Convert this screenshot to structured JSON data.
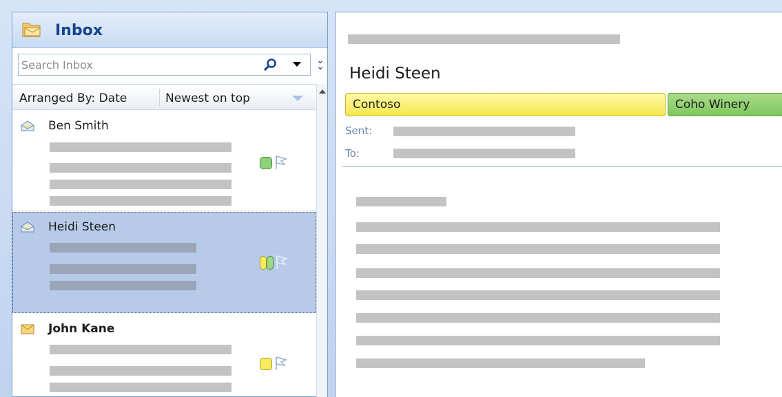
{
  "inbox": {
    "title": "Inbox",
    "search_placeholder": "Search Inbox",
    "arranged_by": "Arranged By: Date",
    "sort_order": "Newest on top"
  },
  "messages": [
    {
      "sender": "Ben Smith",
      "unread": false,
      "categories": [
        "green"
      ],
      "selected": false
    },
    {
      "sender": "Heidi Steen",
      "unread": false,
      "categories": [
        "yellow",
        "green"
      ],
      "selected": true
    },
    {
      "sender": "John Kane",
      "unread": true,
      "categories": [
        "yellow"
      ],
      "selected": false
    }
  ],
  "reading": {
    "subject": "Heidi Steen",
    "categories": [
      "Contoso",
      "Coho Winery"
    ],
    "sent_label": "Sent:",
    "to_label": "To:"
  },
  "colors": {
    "header_text": "#15428b",
    "category_yellow": "#f5e84e",
    "category_green": "#7fc85d",
    "selection": "#b7cbe9"
  }
}
